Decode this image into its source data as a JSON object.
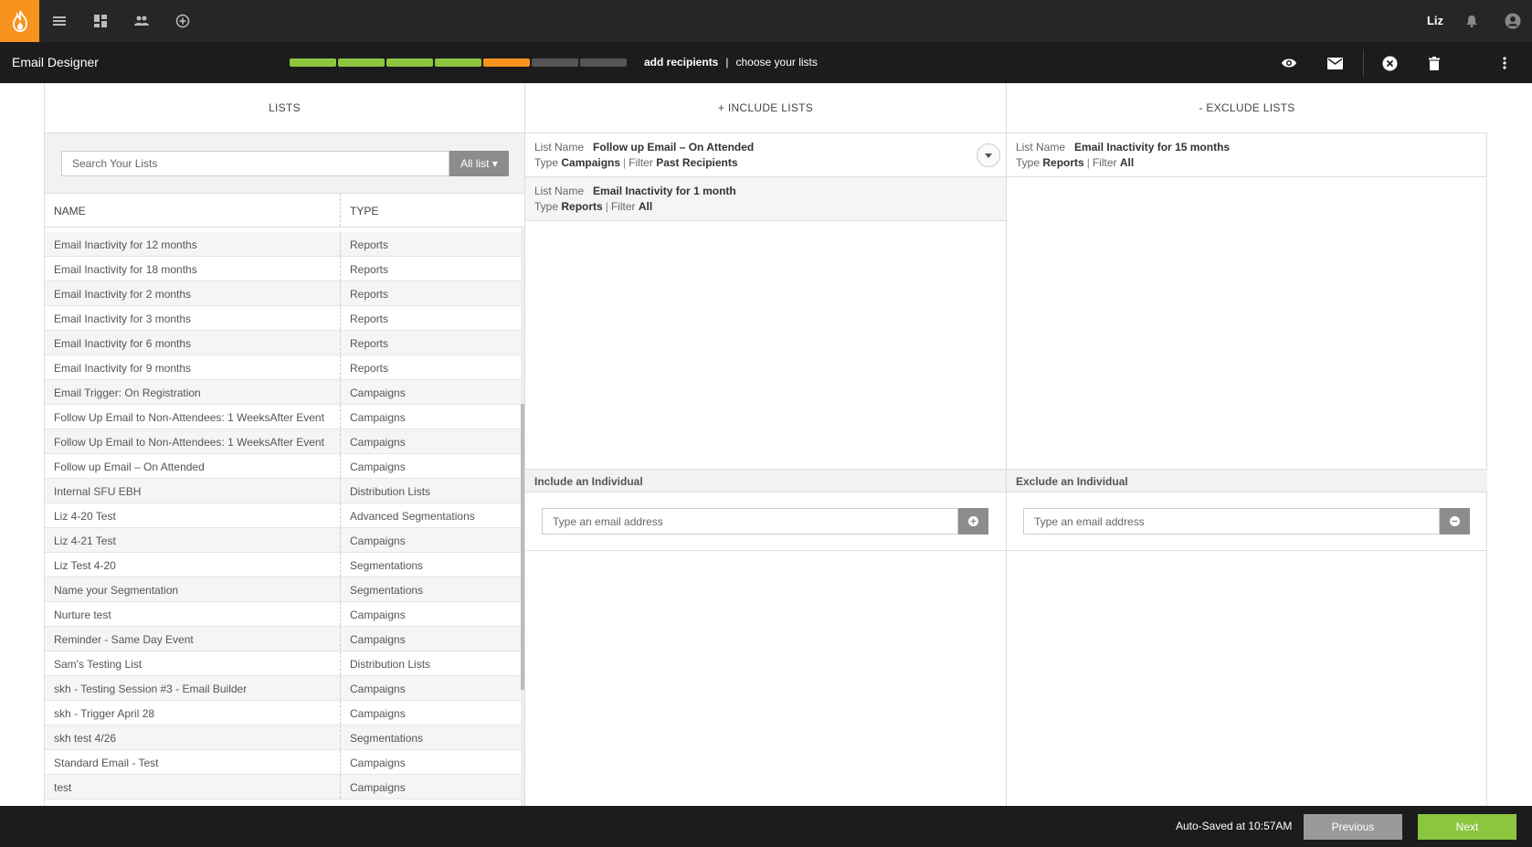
{
  "nav": {
    "user_name": "Liz",
    "icons": [
      "flame-logo-icon",
      "menu-icon",
      "dashboard-icon",
      "people-icon",
      "add-circle-icon",
      "bell-icon",
      "account-icon"
    ],
    "accent_color": "#f7931e"
  },
  "header": {
    "title": "Email Designer",
    "progress": {
      "total_steps": 7,
      "completed_steps": 4,
      "current_step": 5
    },
    "current_step_label": "add recipients",
    "separator": "|",
    "next_step_label": "choose your lists",
    "tool_icons": [
      "preview-eye-icon",
      "email-envelope-icon",
      "close-circle-icon",
      "trash-icon",
      "more-vertical-icon"
    ]
  },
  "lists": {
    "header": "LISTS",
    "search_placeholder": "Search Your Lists",
    "filter_button": "All list ▾",
    "col_name": "NAME",
    "col_type": "TYPE",
    "rows": [
      {
        "name": "Email Inactivity for 12 months",
        "type": "Reports"
      },
      {
        "name": "Email Inactivity for 18 months",
        "type": "Reports"
      },
      {
        "name": "Email Inactivity for 2 months",
        "type": "Reports"
      },
      {
        "name": "Email Inactivity for 3 months",
        "type": "Reports"
      },
      {
        "name": "Email Inactivity for 6 months",
        "type": "Reports"
      },
      {
        "name": "Email Inactivity for 9 months",
        "type": "Reports"
      },
      {
        "name": "Email Trigger: On Registration",
        "type": "Campaigns"
      },
      {
        "name": "Follow Up Email to Non-Attendees: 1 WeeksAfter Event",
        "type": "Campaigns"
      },
      {
        "name": "Follow Up Email to Non-Attendees: 1 WeeksAfter Event",
        "type": "Campaigns"
      },
      {
        "name": "Follow up Email – On Attended",
        "type": "Campaigns"
      },
      {
        "name": "Internal SFU EBH",
        "type": "Distribution Lists"
      },
      {
        "name": "Liz 4-20 Test",
        "type": "Advanced Segmentations"
      },
      {
        "name": "Liz 4-21 Test",
        "type": "Campaigns"
      },
      {
        "name": "Liz Test 4-20",
        "type": "Segmentations"
      },
      {
        "name": "Name your Segmentation",
        "type": "Segmentations"
      },
      {
        "name": "Nurture test",
        "type": "Campaigns"
      },
      {
        "name": "Reminder - Same Day Event",
        "type": "Campaigns"
      },
      {
        "name": "Sam's Testing List",
        "type": "Distribution Lists"
      },
      {
        "name": "skh - Testing Session #3 - Email Builder",
        "type": "Campaigns"
      },
      {
        "name": "skh - Trigger April 28",
        "type": "Campaigns"
      },
      {
        "name": "skh test 4/26",
        "type": "Segmentations"
      },
      {
        "name": "Standard Email - Test",
        "type": "Campaigns"
      },
      {
        "name": "test",
        "type": "Campaigns"
      }
    ]
  },
  "include": {
    "header": "+ INCLUDE LISTS",
    "items": [
      {
        "name_label": "List Name",
        "name": "Follow up Email – On Attended",
        "type_label": "Type",
        "type": "Campaigns",
        "filter_label": "Filter",
        "filter": "Past Recipients"
      },
      {
        "name_label": "List Name",
        "name": "Email Inactivity for 1 month",
        "type_label": "Type",
        "type": "Reports",
        "filter_label": "Filter",
        "filter": "All"
      }
    ],
    "individual_label": "Include an Individual",
    "individual_placeholder": "Type an email address"
  },
  "exclude": {
    "header": "- EXCLUDE LISTS",
    "items": [
      {
        "name_label": "List Name",
        "name": "Email Inactivity for 15 months",
        "type_label": "Type",
        "type": "Reports",
        "filter_label": "Filter",
        "filter": "All"
      }
    ],
    "individual_label": "Exclude an Individual",
    "individual_placeholder": "Type an email address"
  },
  "footer": {
    "autosave": "Auto-Saved at 10:57AM",
    "previous": "Previous",
    "next": "Next",
    "next_color": "#8cc63f"
  }
}
